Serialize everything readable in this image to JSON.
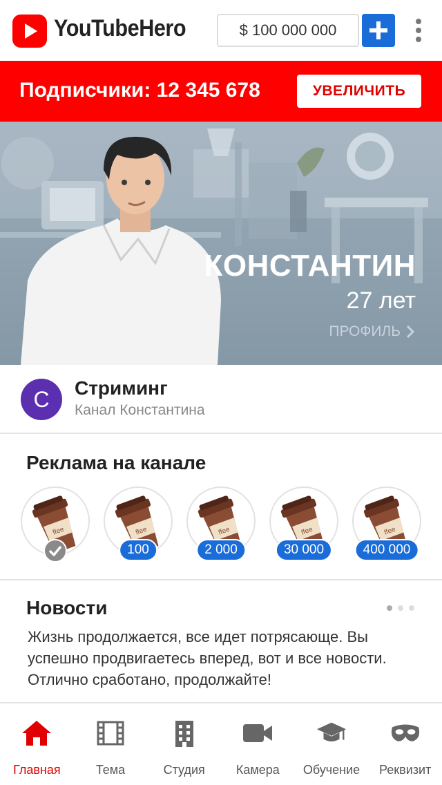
{
  "header": {
    "app_title": "YouTubeHero",
    "money": "$ 100 000 000",
    "add_money_icon": "plus-icon",
    "menu_icon": "more-vertical-icon"
  },
  "subscribers": {
    "text": "Подписчики: 12 345 678",
    "button_label": "УВЕЛИЧИТЬ"
  },
  "hero": {
    "name": "КОНСТАНТИН",
    "age": "27 лет",
    "profile_link": "ПРОФИЛЬ"
  },
  "channel": {
    "avatar_letter": "C",
    "title": "Стриминг",
    "subtitle": "Канал Константина"
  },
  "ads": {
    "title": "Реклама на канале",
    "items": [
      {
        "badge": "",
        "owned": true
      },
      {
        "badge": "100",
        "owned": false
      },
      {
        "badge": "2 000",
        "owned": false
      },
      {
        "badge": "30 000",
        "owned": false
      },
      {
        "badge": "400 000",
        "owned": false
      }
    ]
  },
  "news": {
    "title": "Новости",
    "text": "Жизнь продолжается, все идет потрясающе. Вы успешно продвигаетесь вперед, вот и все новости. Отлично сработано, продолжайте!",
    "page_count": 3,
    "active_page": 1
  },
  "nav": {
    "items": [
      {
        "label": "Главная",
        "icon": "home-icon",
        "active": true
      },
      {
        "label": "Тема",
        "icon": "film-icon",
        "active": false
      },
      {
        "label": "Студия",
        "icon": "building-icon",
        "active": false
      },
      {
        "label": "Камера",
        "icon": "video-camera-icon",
        "active": false
      },
      {
        "label": "Обучение",
        "icon": "graduation-cap-icon",
        "active": false
      },
      {
        "label": "Реквизит",
        "icon": "mask-icon",
        "active": false
      }
    ]
  },
  "colors": {
    "brand_red": "#fe0000",
    "accent_blue": "#1a6cd8",
    "avatar_purple": "#5b2fb0"
  }
}
